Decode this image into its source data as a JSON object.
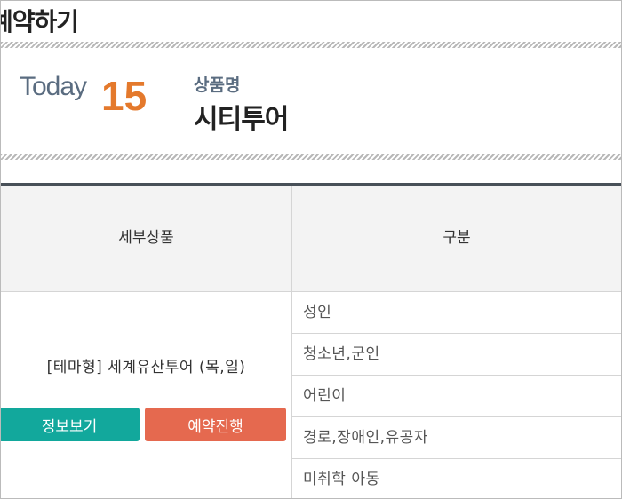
{
  "page": {
    "title": "예약하기"
  },
  "header": {
    "today_label": "Today",
    "day": "15",
    "product_label": "상품명",
    "product_name": "시티투어"
  },
  "table": {
    "headers": [
      "세부상품",
      "구분"
    ],
    "tour_name": "[테마형] 세계유산투어 (목,일)",
    "buttons": {
      "info": "정보보기",
      "book": "예약진행"
    },
    "categories": [
      "성인",
      "청소년,군인",
      "어린이",
      "경로,장애인,유공자",
      "미취학 아동"
    ]
  },
  "colors": {
    "accent_orange": "#e4792c",
    "info_button": "#12a89c",
    "book_button": "#e5694f",
    "header_bg": "#f3f3f3"
  }
}
